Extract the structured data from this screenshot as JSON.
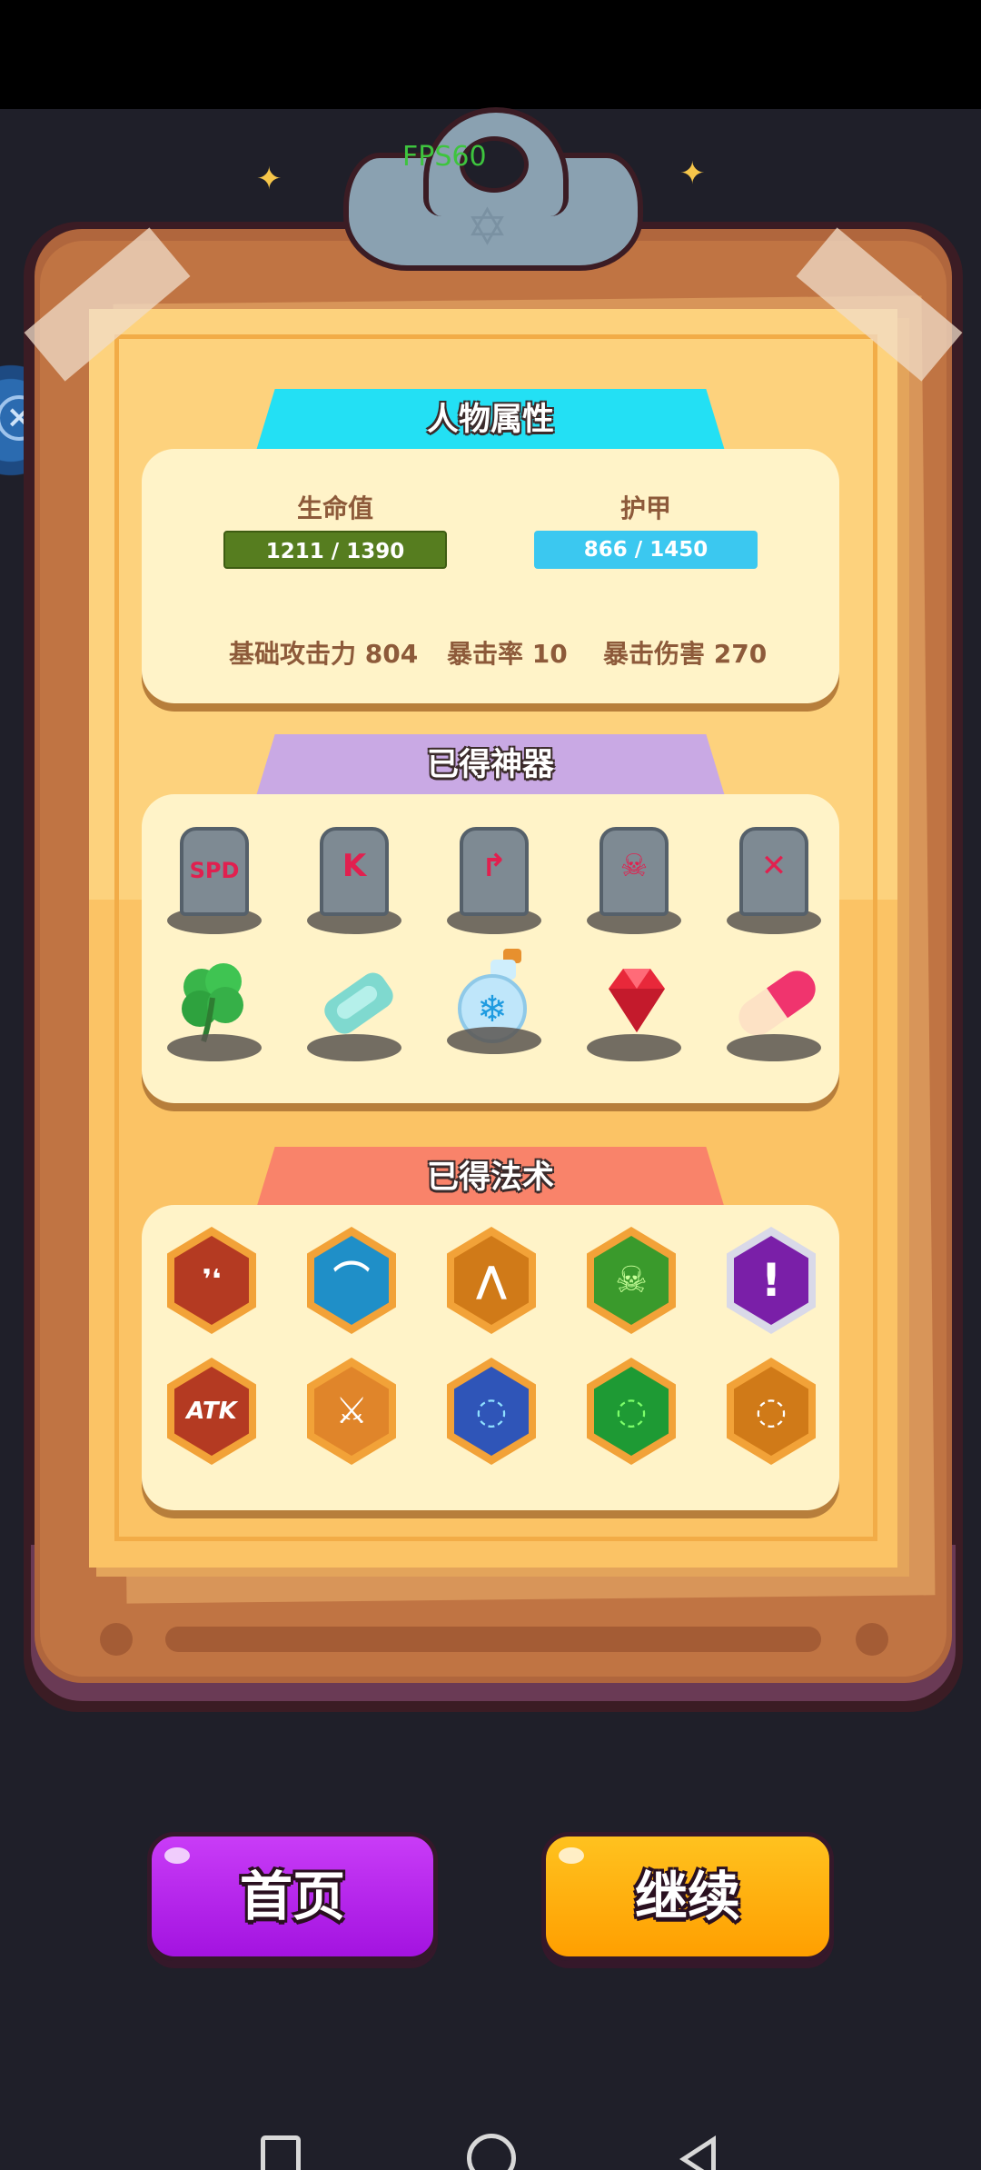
{
  "hud": {
    "fps": "FPS60"
  },
  "attributes": {
    "title": "人物属性",
    "hp_label": "生命值",
    "hp_value": "1211 / 1390",
    "hp_fraction": 0.871,
    "armor_label": "护甲",
    "armor_value": "866 / 1450",
    "armor_fraction": 0.597,
    "attack": "基础攻击力 804",
    "crit_rate": "暴击率 10",
    "crit_damage": "暴击伤害 270"
  },
  "artifacts": {
    "title": "已得神器",
    "items": [
      {
        "name": "tombstone-spd-icon",
        "rune": "SPD"
      },
      {
        "name": "tombstone-k-rune-icon",
        "rune": "K"
      },
      {
        "name": "tombstone-boot-icon",
        "rune": "↱"
      },
      {
        "name": "tombstone-skull-icon",
        "rune": "☠"
      },
      {
        "name": "tombstone-cross-arrows-icon",
        "rune": "✕"
      },
      {
        "name": "four-leaf-clover-icon"
      },
      {
        "name": "soap-bar-icon"
      },
      {
        "name": "snowflake-potion-icon"
      },
      {
        "name": "red-gem-icon"
      },
      {
        "name": "pill-capsule-icon"
      }
    ]
  },
  "spells": {
    "title": "已得法术",
    "items": [
      {
        "name": "twin-fang-spell-icon",
        "glyph": "❜❛"
      },
      {
        "name": "dash-gate-spell-icon",
        "glyph": "⌒"
      },
      {
        "name": "triple-arrow-spell-icon",
        "glyph": "⋀"
      },
      {
        "name": "poison-skull-spell-icon",
        "glyph": "☠"
      },
      {
        "name": "exclamation-spell-icon",
        "glyph": "!"
      },
      {
        "name": "atk-up-spell-icon",
        "glyph": "ATK"
      },
      {
        "name": "crossed-swords-spell-icon",
        "glyph": "⚔"
      },
      {
        "name": "blue-orbit-spell-icon",
        "glyph": "◌"
      },
      {
        "name": "green-orbit-spell-icon",
        "glyph": "◌"
      },
      {
        "name": "orange-orbit-spell-icon",
        "glyph": "◌"
      }
    ]
  },
  "buttons": {
    "home": "首页",
    "continue": "继续"
  },
  "colors": {
    "hp_bar": "#567d1f",
    "armor_bar": "#3bc8f0",
    "home_button": "#b81ef0",
    "continue_button": "#ffb300"
  }
}
